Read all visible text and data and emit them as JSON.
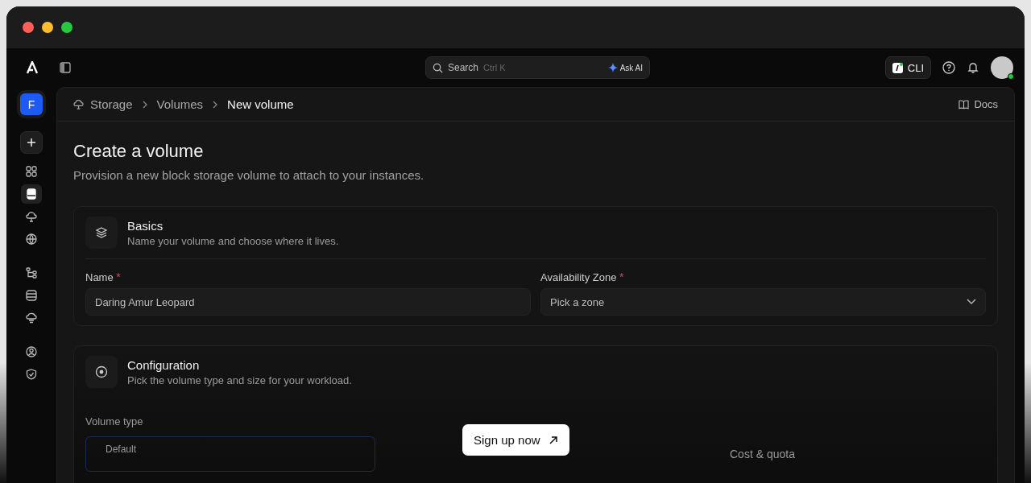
{
  "topbar": {
    "search": {
      "placeholder": "Search",
      "shortcut": "Ctrl K",
      "ai_button": "Ask AI"
    },
    "cli_button": "CLI"
  },
  "sidebar": {
    "workspace": "F",
    "items": [
      {
        "kind": "grid",
        "selected": false
      },
      {
        "kind": "storage",
        "selected": true
      },
      {
        "kind": "cloud",
        "selected": false
      },
      {
        "kind": "globe",
        "selected": false
      },
      {
        "kind": "tree",
        "selected": false
      },
      {
        "kind": "server",
        "selected": false
      },
      {
        "kind": "clouddb",
        "selected": false
      },
      {
        "kind": "user",
        "selected": false
      },
      {
        "kind": "shield",
        "selected": false
      }
    ]
  },
  "breadcrumb": [
    "Storage",
    "Volumes",
    "New volume"
  ],
  "docs_link": "Docs",
  "page": {
    "title": "Create a volume",
    "subtitle": "Provision a new block storage volume to attach to your instances."
  },
  "sections": [
    {
      "kind": "layers",
      "title": "Basics",
      "subtitle": "Name your volume and choose where it lives.",
      "fields": [
        {
          "kind": "text",
          "label": "Name",
          "required_mark": "*",
          "value": "Daring Amur Leopard"
        },
        {
          "kind": "select",
          "label": "Availability Zone",
          "required_mark": "*",
          "placeholder": "Pick a zone"
        }
      ]
    },
    {
      "kind": "disc",
      "title": "Configuration",
      "subtitle": "Pick the volume type and size for your workload.",
      "faded_label": "Volume type",
      "faded_option": "Default",
      "faded_note": "Cost & quota"
    }
  ],
  "signup_button": "Sign up now"
}
